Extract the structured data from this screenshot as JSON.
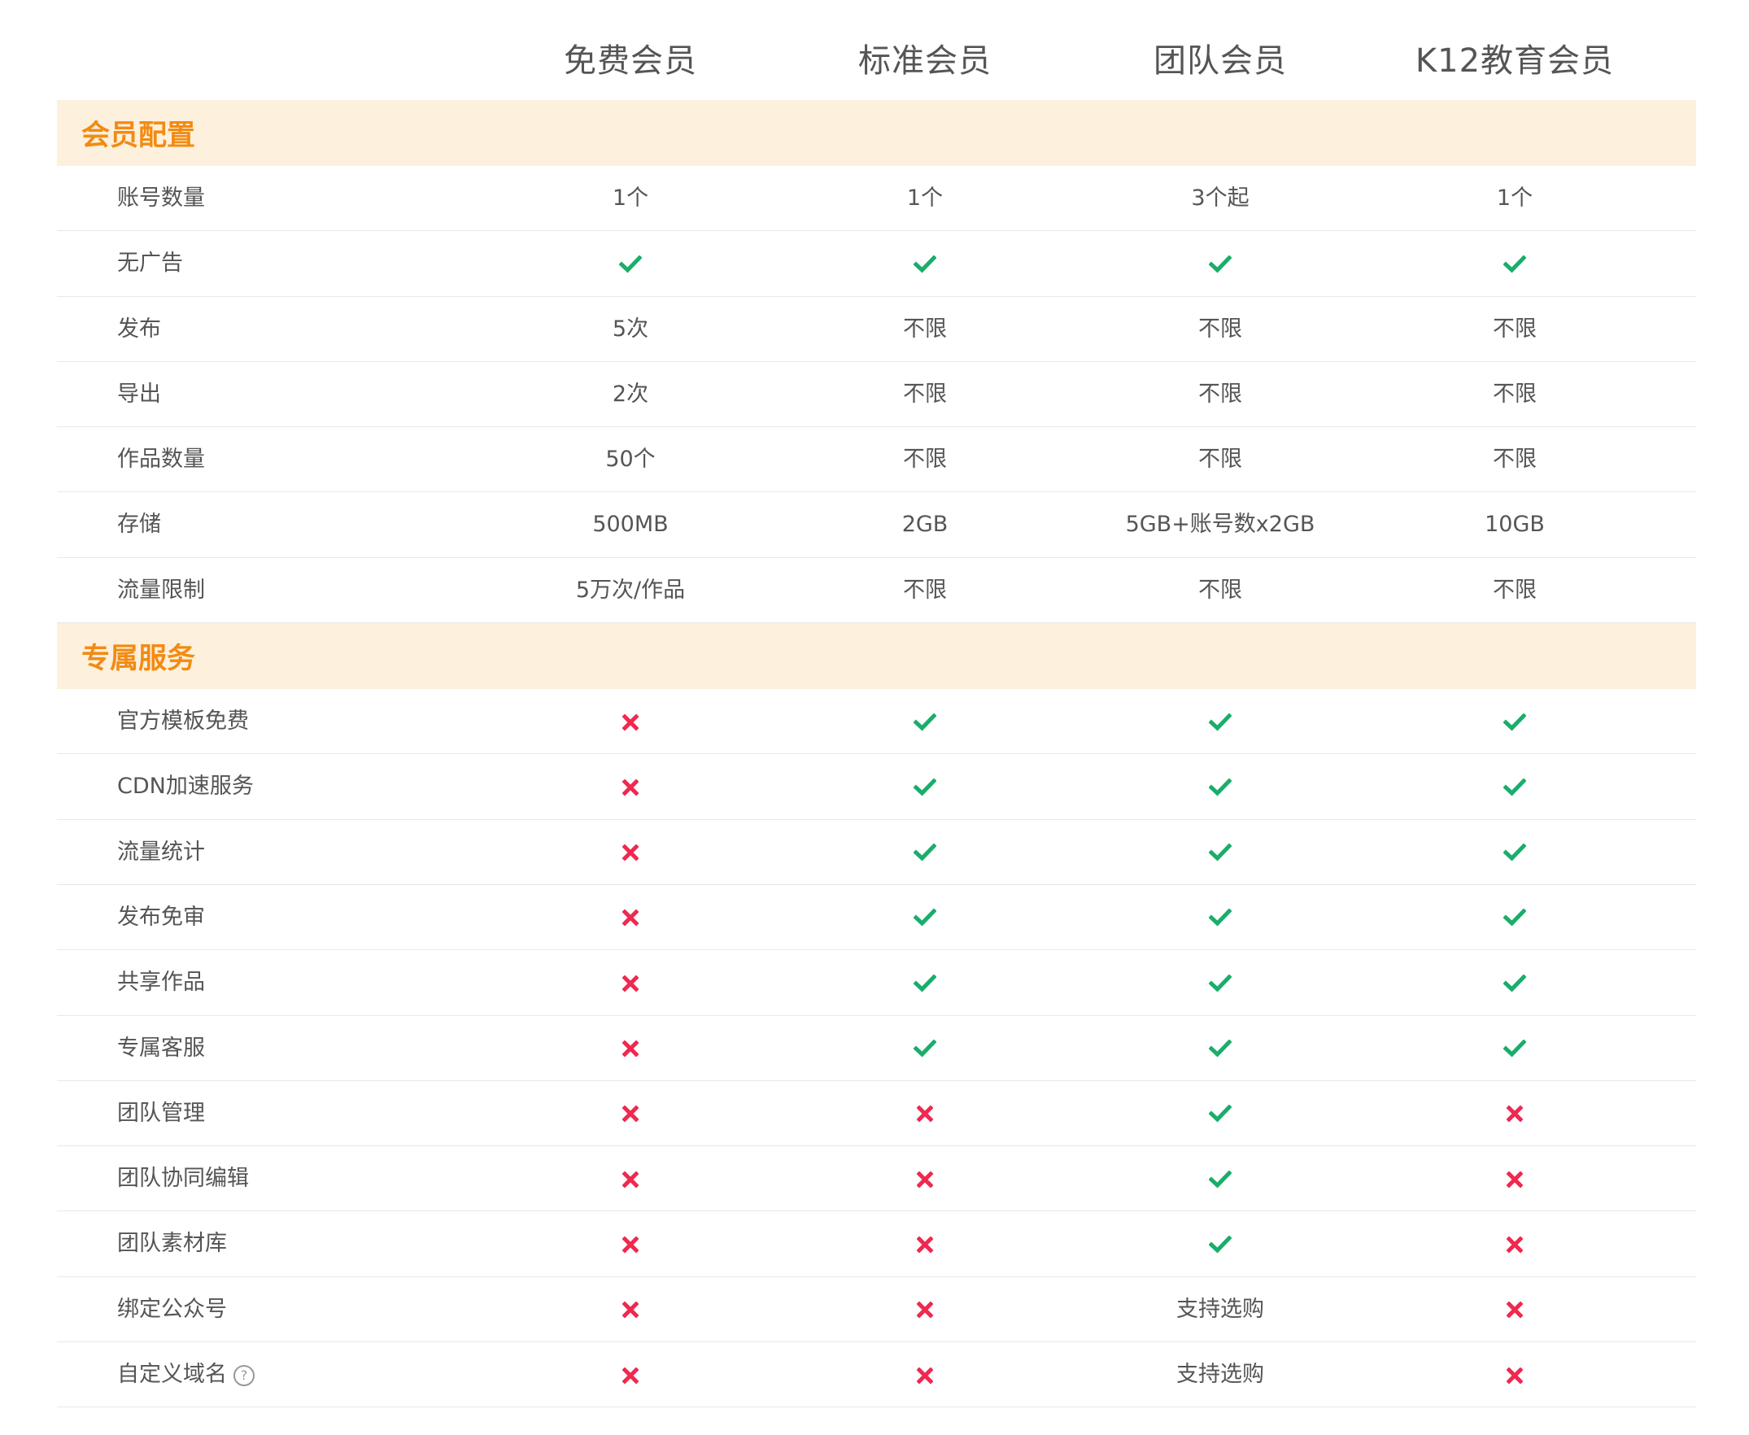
{
  "plans": [
    "免费会员",
    "标准会员",
    "团队会员",
    "K12教育会员"
  ],
  "colors": {
    "section_bg": "#fdf0dd",
    "section_title": "#f28b12",
    "check": "#1aad6b",
    "cross": "#f0284f",
    "border": "#e8e8e8"
  },
  "icons": {
    "check": "check-icon",
    "cross": "cross-icon",
    "help": "question-circle-icon"
  },
  "sections": [
    {
      "title": "会员配置",
      "rows": [
        {
          "label": "账号数量",
          "values": [
            "1个",
            "1个",
            "3个起",
            "1个"
          ]
        },
        {
          "label": "无广告",
          "values": [
            "check",
            "check",
            "check",
            "check"
          ]
        },
        {
          "label": "发布",
          "values": [
            "5次",
            "不限",
            "不限",
            "不限"
          ]
        },
        {
          "label": "导出",
          "values": [
            "2次",
            "不限",
            "不限",
            "不限"
          ]
        },
        {
          "label": "作品数量",
          "values": [
            "50个",
            "不限",
            "不限",
            "不限"
          ]
        },
        {
          "label": "存储",
          "values": [
            "500MB",
            "2GB",
            "5GB+账号数x2GB",
            "10GB"
          ]
        },
        {
          "label": "流量限制",
          "values": [
            "5万次/作品",
            "不限",
            "不限",
            "不限"
          ]
        }
      ]
    },
    {
      "title": "专属服务",
      "rows": [
        {
          "label": "官方模板免费",
          "values": [
            "cross",
            "check",
            "check",
            "check"
          ]
        },
        {
          "label": "CDN加速服务",
          "values": [
            "cross",
            "check",
            "check",
            "check"
          ]
        },
        {
          "label": "流量统计",
          "values": [
            "cross",
            "check",
            "check",
            "check"
          ]
        },
        {
          "label": "发布免审",
          "values": [
            "cross",
            "check",
            "check",
            "check"
          ]
        },
        {
          "label": "共享作品",
          "values": [
            "cross",
            "check",
            "check",
            "check"
          ]
        },
        {
          "label": "专属客服",
          "values": [
            "cross",
            "check",
            "check",
            "check"
          ]
        },
        {
          "label": "团队管理",
          "values": [
            "cross",
            "cross",
            "check",
            "cross"
          ]
        },
        {
          "label": "团队协同编辑",
          "values": [
            "cross",
            "cross",
            "check",
            "cross"
          ]
        },
        {
          "label": "团队素材库",
          "values": [
            "cross",
            "cross",
            "check",
            "cross"
          ]
        },
        {
          "label": "绑定公众号",
          "values": [
            "cross",
            "cross",
            "支持选购",
            "cross"
          ]
        },
        {
          "label": "自定义域名",
          "help": true,
          "values": [
            "cross",
            "cross",
            "支持选购",
            "cross"
          ]
        }
      ]
    }
  ]
}
